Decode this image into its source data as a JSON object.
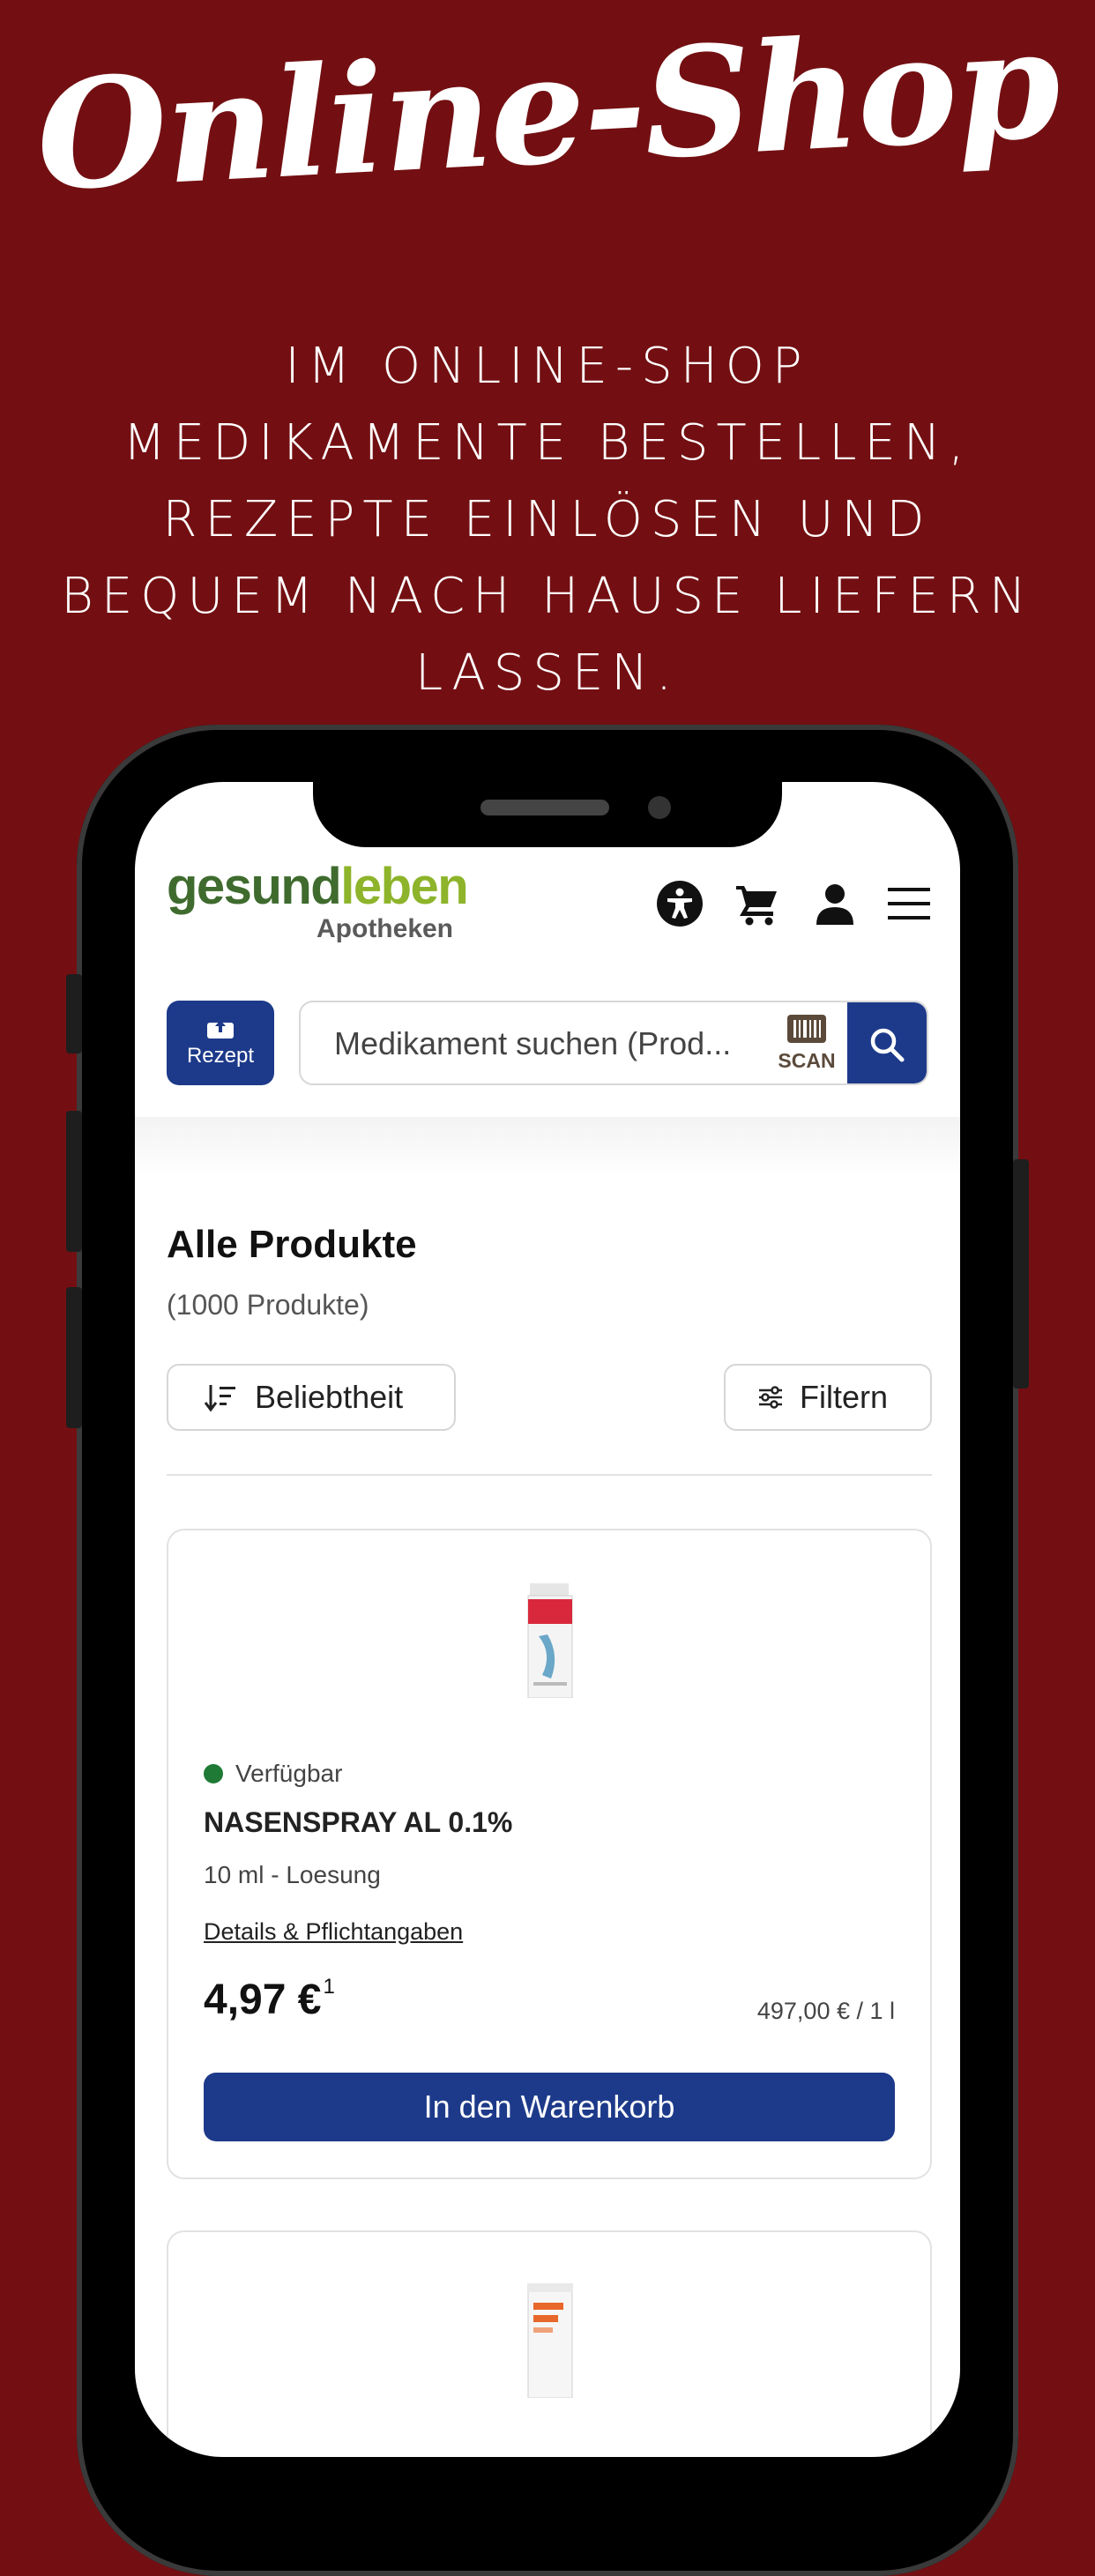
{
  "hero": {
    "title": "Online-Shop",
    "subtitle": "IM ONLINE-SHOP MEDIKAMENTE BESTELLEN, REZEPTE EINLÖSEN UND BEQUEM NACH HAUSE LIEFERN LASSEN."
  },
  "app": {
    "logo": {
      "brand_dark": "gesund",
      "brand_light": "leben",
      "sub": "Apotheken"
    },
    "header_icons": [
      "accessibility-icon",
      "cart-icon",
      "user-icon",
      "menu-icon"
    ],
    "rx_button": {
      "label": "Rezept"
    },
    "search": {
      "placeholder": "Medikament suchen (Prod...",
      "scan_label": "SCAN"
    },
    "listing": {
      "title": "Alle Produkte",
      "count": "(1000 Produkte)",
      "sort_label": "Beliebtheit",
      "filter_label": "Filtern"
    },
    "products": [
      {
        "availability": "Verfügbar",
        "name": "NASENSPRAY AL 0.1%",
        "volume": "10 ml - Loesung",
        "details_link": "Details & Pflichtangaben",
        "price": "4,97 €",
        "price_footnote": "1",
        "unit_price": "497,00 € / 1 l",
        "cart_button": "In den Warenkorb"
      }
    ],
    "colors": {
      "primary": "#1d3a8a",
      "available": "#1f7a35",
      "background": "#730f12"
    }
  }
}
